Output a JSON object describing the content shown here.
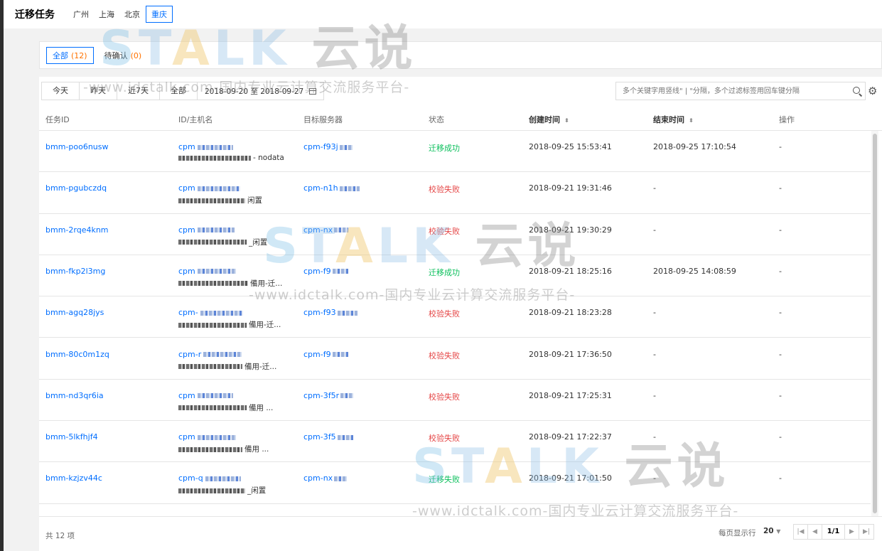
{
  "header": {
    "title": "迁移任务",
    "regions": [
      {
        "label": "广州",
        "active": false
      },
      {
        "label": "上海",
        "active": false
      },
      {
        "label": "北京",
        "active": false
      },
      {
        "label": "重庆",
        "active": true
      }
    ]
  },
  "tabs": [
    {
      "label": "全部",
      "count": "(12)",
      "active": true
    },
    {
      "label": "待确认",
      "count": "(0)",
      "active": false
    }
  ],
  "filters": {
    "quick_ranges": [
      "今天",
      "昨天",
      "近7天",
      "全部"
    ],
    "date_range": "2018-09-20 至 2018-09-27",
    "search_placeholder": "多个关键字用竖线\" | \"分隔，多个过滤标签用回车键分隔"
  },
  "table": {
    "columns": [
      "任务ID",
      "ID/主机名",
      "目标服务器",
      "状态",
      "创建时间",
      "结束时间",
      "操作"
    ],
    "rows": [
      {
        "task_id": "bmm-poo6nusw",
        "host_id": "cpm",
        "host_name": "- nodata",
        "target": "cpm-f93j",
        "status": "迁移成功",
        "status_type": "ok",
        "created": "2018-09-25 15:53:41",
        "ended": "2018-09-25 17:10:54",
        "action": "-"
      },
      {
        "task_id": "bmm-pgubczdq",
        "host_id": "cpm",
        "host_name": "闲置",
        "target": "cpm-n1h",
        "status": "校验失败",
        "status_type": "fail",
        "created": "2018-09-21 19:31:46",
        "ended": "-",
        "action": "-"
      },
      {
        "task_id": "bmm-2rqe4knm",
        "host_id": "cpm",
        "host_name": "_闲置",
        "target": "cpm-nx",
        "status": "校验失败",
        "status_type": "fail",
        "created": "2018-09-21 19:30:29",
        "ended": "-",
        "action": "-"
      },
      {
        "task_id": "bmm-fkp2l3mg",
        "host_id": "cpm",
        "host_name": "備用-迁...",
        "target": "cpm-f9",
        "status": "迁移成功",
        "status_type": "ok",
        "created": "2018-09-21 18:25:16",
        "ended": "2018-09-25 14:08:59",
        "action": "-"
      },
      {
        "task_id": "bmm-agq28jys",
        "host_id": "cpm-",
        "host_name": "備用-迁...",
        "target": "cpm-f93",
        "status": "校验失败",
        "status_type": "fail",
        "created": "2018-09-21 18:23:28",
        "ended": "-",
        "action": "-"
      },
      {
        "task_id": "bmm-80c0m1zq",
        "host_id": "cpm-r",
        "host_name": "備用-迁...",
        "target": "cpm-f9",
        "status": "校验失败",
        "status_type": "fail",
        "created": "2018-09-21 17:36:50",
        "ended": "-",
        "action": "-"
      },
      {
        "task_id": "bmm-nd3qr6ia",
        "host_id": "cpm",
        "host_name": "備用 ...",
        "target": "cpm-3f5r",
        "status": "校验失败",
        "status_type": "fail",
        "created": "2018-09-21 17:25:31",
        "ended": "-",
        "action": "-"
      },
      {
        "task_id": "bmm-5lkfhjf4",
        "host_id": "cpm",
        "host_name": "備用 ...",
        "target": "cpm-3f5",
        "status": "校验失败",
        "status_type": "fail",
        "created": "2018-09-21 17:22:37",
        "ended": "-",
        "action": "-"
      },
      {
        "task_id": "bmm-kzjzv44c",
        "host_id": "cpm-q",
        "host_name": "_闲置",
        "target": "cpm-nx",
        "status": "迁移失败",
        "status_type": "ok",
        "created": "2018-09-21 17:01:50",
        "ended": "-",
        "action": "-"
      }
    ]
  },
  "footer": {
    "total": "共 12 项",
    "per_page_label": "每页显示行",
    "per_page": "20",
    "page": "1/1"
  },
  "watermark": {
    "logo_text": "TALK 云说",
    "url_text": "-www.idctalk.com-国内专业云计算交流服务平台-"
  }
}
